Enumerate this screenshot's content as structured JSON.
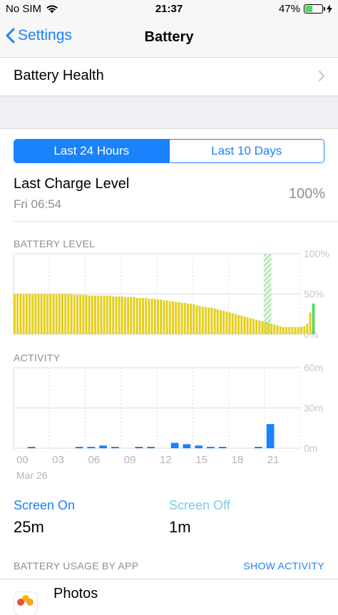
{
  "status": {
    "carrier": "No SIM",
    "time": "21:37",
    "battery_percent": "47%",
    "battery_level": 0.47,
    "wifi_icon": "wifi-icon",
    "charging_icon": "bolt-icon"
  },
  "nav": {
    "back_label": "Settings",
    "title": "Battery"
  },
  "health": {
    "label": "Battery Health"
  },
  "segments": [
    {
      "label": "Last 24 Hours",
      "active": true
    },
    {
      "label": "Last 10 Days",
      "active": false
    }
  ],
  "last_charge": {
    "title": "Last Charge Level",
    "date": "Fri 06:54",
    "value": "100%"
  },
  "sections": {
    "battery_level": "BATTERY LEVEL",
    "activity": "ACTIVITY",
    "usage_by_app": "BATTERY USAGE BY APP",
    "show_activity": "SHOW ACTIVITY"
  },
  "usage": {
    "screen_on_label": "Screen On",
    "screen_on_value": "25m",
    "screen_off_label": "Screen Off",
    "screen_off_value": "1m"
  },
  "apps": [
    {
      "name": "Photos"
    }
  ],
  "colors": {
    "accent": "#1a82fb",
    "battery_bar": "#e4cf1d",
    "charging": "#4cd964",
    "activity_bar": "#1a82fb",
    "screen_off": "#7ecbe0"
  },
  "chart_data": [
    {
      "type": "bar",
      "name": "BATTERY LEVEL",
      "x_tick_labels": [
        "00",
        "03",
        "06",
        "09",
        "12",
        "15",
        "18",
        "21"
      ],
      "y_tick_labels": [
        "100%",
        "50%",
        "0%"
      ],
      "ylim": [
        0,
        100
      ],
      "x_hours_start": 0,
      "bars_per_hour": 4,
      "values": [
        50,
        50,
        50,
        50,
        50,
        50,
        50,
        50,
        50,
        50,
        50,
        50,
        50,
        50,
        50,
        50,
        50,
        50,
        50,
        50,
        49,
        49,
        49,
        49,
        49,
        48,
        48,
        48,
        48,
        48,
        48,
        48,
        48,
        47,
        47,
        47,
        47,
        46,
        46,
        46,
        46,
        45,
        45,
        45,
        45,
        44,
        44,
        44,
        43,
        43,
        42,
        42,
        41,
        41,
        40,
        40,
        39,
        39,
        38,
        38,
        37,
        36,
        35,
        34,
        34,
        33,
        33,
        32,
        31,
        30,
        29,
        28,
        27,
        26,
        25,
        24,
        23,
        22,
        21,
        20,
        19,
        18,
        17,
        16,
        15,
        14,
        13,
        12,
        11,
        10,
        9,
        9,
        9,
        9,
        9,
        9,
        9,
        10,
        13,
        27,
        38
      ],
      "charging": {
        "bar_index": 100,
        "value": 38,
        "plug_in_hour": 21.0,
        "plug_in_to_value": 100
      }
    },
    {
      "type": "bar",
      "name": "ACTIVITY",
      "x_tick_labels": [
        "00",
        "03",
        "06",
        "09",
        "12",
        "15",
        "18",
        "21"
      ],
      "x_sub_label": "Mar 26",
      "y_tick_labels": [
        "60m",
        "30m",
        "0m"
      ],
      "ylim": [
        0,
        60
      ],
      "units": "minutes",
      "bars": [
        {
          "hour": 1,
          "screen_on": 1,
          "screen_off": 0
        },
        {
          "hour": 5,
          "screen_on": 1,
          "screen_off": 0
        },
        {
          "hour": 6,
          "screen_on": 1,
          "screen_off": 0
        },
        {
          "hour": 7,
          "screen_on": 2,
          "screen_off": 0
        },
        {
          "hour": 8,
          "screen_on": 1,
          "screen_off": 0
        },
        {
          "hour": 10,
          "screen_on": 1,
          "screen_off": 0
        },
        {
          "hour": 11,
          "screen_on": 1,
          "screen_off": 0
        },
        {
          "hour": 13,
          "screen_on": 4,
          "screen_off": 0
        },
        {
          "hour": 14,
          "screen_on": 3,
          "screen_off": 0
        },
        {
          "hour": 15,
          "screen_on": 2,
          "screen_off": 0
        },
        {
          "hour": 16,
          "screen_on": 1,
          "screen_off": 0
        },
        {
          "hour": 17,
          "screen_on": 1,
          "screen_off": 0
        },
        {
          "hour": 20,
          "screen_on": 1,
          "screen_off": 0
        },
        {
          "hour": 21,
          "screen_on": 18,
          "screen_off": 0
        }
      ]
    }
  ]
}
